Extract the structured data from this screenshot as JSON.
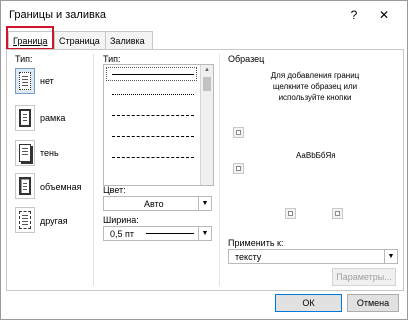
{
  "window": {
    "title": "Границы и заливка",
    "help_glyph": "?",
    "close_glyph": "✕"
  },
  "tabs": [
    {
      "label": "Граница",
      "active": true
    },
    {
      "label": "Страница",
      "active": false
    },
    {
      "label": "Заливка",
      "active": false
    }
  ],
  "settings": {
    "label": "Тип:",
    "items": [
      {
        "label": "нет",
        "icon": "border-none-icon",
        "selected": true
      },
      {
        "label": "рамка",
        "icon": "border-box-icon",
        "selected": false
      },
      {
        "label": "тень",
        "icon": "border-shadow-icon",
        "selected": false
      },
      {
        "label": "объемная",
        "icon": "border-3d-icon",
        "selected": false
      },
      {
        "label": "другая",
        "icon": "border-custom-icon",
        "selected": false
      }
    ]
  },
  "style": {
    "label": "Тип:",
    "lines": [
      "solid",
      "dotted",
      "dashed-small",
      "dashed-medium",
      "dash-dot"
    ],
    "color_label": "Цвет:",
    "color_value": "Авто",
    "width_label": "Ширина:",
    "width_value": "0,5 пт"
  },
  "preview": {
    "label": "Образец",
    "hint": "Для добавления границ щелкните образец или используйте кнопки",
    "sample_text": "АаBbБбЯя",
    "apply_label": "Применить к:",
    "apply_value": "тексту",
    "options_button": "Параметры..."
  },
  "buttons": {
    "ok": "ОК",
    "cancel": "Отмена"
  },
  "colors": {
    "highlight": "#d0142a",
    "selected_bg": "#dce9f7",
    "accent": "#0078d7"
  }
}
